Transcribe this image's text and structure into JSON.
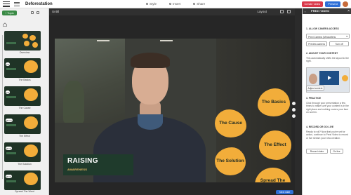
{
  "app": {
    "title": "Deforestation"
  },
  "toolbar": {
    "tabs": [
      "Style",
      "Insert",
      "Share"
    ],
    "create_video": "Create video",
    "present": "Present"
  },
  "left_panel": {
    "topic_button": "+ Topic",
    "thumbs": [
      {
        "label": "Overview",
        "num": ""
      },
      {
        "label": "The Basics",
        "num": "0:0"
      },
      {
        "label": "The Cause",
        "num": "0:0"
      },
      {
        "label": "The Effect",
        "num": "00:10"
      },
      {
        "label": "The Solution",
        "num": "00:11"
      },
      {
        "label": "Spread The Word",
        "num": "00:11"
      }
    ]
  },
  "canvas": {
    "title": "Untitl",
    "layout_label": "Layout",
    "caption_title": "RAISING",
    "caption_sub": "AWARENESS",
    "bubbles": {
      "basics": "The Basics",
      "cause": "The Cause",
      "effect": "The Effect",
      "solution": "The Solution",
      "spread": "Spread The Word"
    },
    "next_button": "Next slide"
  },
  "right_panel": {
    "header": "PREZI VIDEO",
    "s1_title": "1. ALLOW CAMERA ACCESS",
    "camera_select": "Prezi Camera (Mirosoftens",
    "preview_camera": "Preview camera",
    "turn_off": "Turn off",
    "s2_title": "2. ADJUST YOUR CONTENT",
    "s2_text": "This automatically shifts the layout to the right.",
    "adjust_content": "Adjust content",
    "s3_title": "3. PRACTICE",
    "s3_text": "Click through your presentation a few times to make sure your content is in the right place and nothing covers your face on screen.",
    "s4_title": "4. RECORD OR GO LIVE",
    "s4_text": "Ready to roll? Now that you're set for action, continue to Prezi Video to record or live stream your new creation.",
    "record_video": "Record video",
    "go_live": "Go live"
  }
}
